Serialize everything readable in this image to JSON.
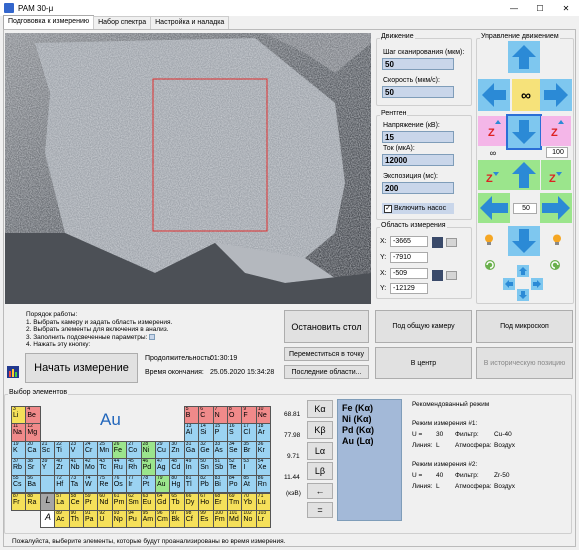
{
  "window": {
    "title": "РАМ 30-μ",
    "minimize": "—",
    "maximize": "☐",
    "close": "✕"
  },
  "tabs": [
    "Подгововка к измерению",
    "Набор спектра",
    "Настройка и наладка"
  ],
  "colors": {
    "accent": "#36c",
    "field": "#c9d6ea",
    "arrow": "#7ec7ef",
    "pink": "#f4b6e8",
    "green": "#9be58c"
  },
  "movement": {
    "group": "Движение",
    "step_label": "Шаг сканирования (мкм):",
    "step_value": "50",
    "speed_label": "Скорость (мкм/с):",
    "speed_value": "50"
  },
  "xray": {
    "group": "Рентген",
    "voltage_label": "Напряжение (кВ):",
    "voltage_value": "15",
    "current_label": "Ток (мкА):",
    "current_value": "12000",
    "exposure_label": "Экспозиция (мс):",
    "exposure_value": "200",
    "pump_label": "Включить насос"
  },
  "area": {
    "group": "Область измерения",
    "x1": "-3665",
    "y1": "-7910",
    "x2": "-509",
    "y2": "-12129",
    "x_label": "X:",
    "y_label": "Y:"
  },
  "control": {
    "group": "Управление движением",
    "inf": "∞",
    "speed_inf": "∞",
    "speed_100": "100",
    "step_50": "50"
  },
  "procedure": {
    "title": "Порядок работы:",
    "steps": [
      "1. Выбрать камеру и задать область измерения.",
      "2. Выбрать элементы для включения в анализ.",
      "3. Заполнить подсвеченные параметры:",
      "4. Нажать эту кнопку:"
    ]
  },
  "actions": {
    "stop_table": "Остановить стол",
    "general_camera": "Под общую камеру",
    "microscope": "Под микроскоп",
    "move_to_point": "Переместиться в точку",
    "last_areas": "Последние области...",
    "center": "В центр",
    "historic": "В историческую позицию",
    "start": "Начать измерение"
  },
  "timing": {
    "duration_label": "Продолжительность:",
    "duration_value": "01:30:19",
    "end_label": "Время окончания:",
    "end_value": "25.05.2020 15:34:28"
  },
  "elements": {
    "group": "Выбор элементов",
    "selected_symbol": "Au",
    "lines": [
      "Kα",
      "Kβ",
      "Lα",
      "Lβ",
      "←",
      "="
    ],
    "energies": [
      "68.81",
      "77.98",
      "9.71",
      "11.44",
      "(кэВ)"
    ],
    "selected_list": [
      "Fe (Kα)",
      "Ni (Kα)",
      "Pd (Kα)",
      "Au (Lα)"
    ],
    "footer": "Пожалуйста, выберите элементы, которые будут проанализированы во время измерения."
  },
  "recommended": {
    "group": "Рекомендованный режим",
    "mode1": {
      "title": "Режим измерения #1:",
      "u_label": "U =",
      "u": "30",
      "filter_label": "Фильтр:",
      "filter": "Cu-40",
      "line_label": "Линия:",
      "line": "L",
      "atm_label": "Атмосфера:",
      "atm": "Воздух"
    },
    "mode2": {
      "title": "Режим измерения #2:",
      "u_label": "U =",
      "u": "40",
      "filter_label": "Фильтр:",
      "filter": "Zr-50",
      "line_label": "Линия:",
      "line": "L",
      "atm_label": "Атмосфера:",
      "atm": "Воздух"
    }
  },
  "periodic": [
    [
      "5",
      "B",
      "#f08a8a"
    ],
    [
      "6",
      "C",
      "#f08a8a"
    ],
    [
      "7",
      "N",
      "#f08a8a"
    ],
    [
      "8",
      "O",
      "#f08a8a"
    ],
    [
      "9",
      "F",
      "#f08a8a"
    ],
    [
      "10",
      "Ne",
      "#f08a8a"
    ],
    [
      "3",
      "Li",
      "#f5e05a"
    ],
    [
      "4",
      "Be",
      "#f08a8a"
    ],
    [
      "11",
      "Na",
      "#f08a8a"
    ],
    [
      "12",
      "Mg",
      "#f08a8a"
    ],
    [
      "13",
      "Al",
      "#9bd3f2"
    ],
    [
      "14",
      "Si",
      "#9bd3f2"
    ],
    [
      "15",
      "P",
      "#9bd3f2"
    ],
    [
      "16",
      "S",
      "#9bd3f2"
    ],
    [
      "17",
      "Cl",
      "#9bd3f2"
    ],
    [
      "18",
      "Ar",
      "#9bd3f2"
    ],
    [
      "19",
      "K",
      "#9bd3f2"
    ],
    [
      "20",
      "Ca",
      "#9bd3f2"
    ],
    [
      "21",
      "Sc",
      "#9bd3f2"
    ],
    [
      "22",
      "Ti",
      "#9bd3f2"
    ],
    [
      "23",
      "V",
      "#9bd3f2"
    ],
    [
      "24",
      "Cr",
      "#9bd3f2"
    ],
    [
      "25",
      "Mn",
      "#9bd3f2"
    ],
    [
      "26",
      "Fe",
      "#9be58c"
    ],
    [
      "27",
      "Co",
      "#9bd3f2"
    ],
    [
      "28",
      "Ni",
      "#9be58c"
    ],
    [
      "29",
      "Cu",
      "#9bd3f2"
    ],
    [
      "30",
      "Zn",
      "#9bd3f2"
    ],
    [
      "31",
      "Ga",
      "#9bd3f2"
    ],
    [
      "32",
      "Ge",
      "#9bd3f2"
    ],
    [
      "33",
      "As",
      "#9bd3f2"
    ],
    [
      "34",
      "Se",
      "#9bd3f2"
    ],
    [
      "35",
      "Br",
      "#9bd3f2"
    ],
    [
      "36",
      "Kr",
      "#9bd3f2"
    ],
    [
      "37",
      "Rb",
      "#9bd3f2"
    ],
    [
      "38",
      "Sr",
      "#9bd3f2"
    ],
    [
      "39",
      "Y",
      "#9bd3f2"
    ],
    [
      "40",
      "Zr",
      "#9bd3f2"
    ],
    [
      "41",
      "Nb",
      "#9bd3f2"
    ],
    [
      "42",
      "Mo",
      "#9bd3f2"
    ],
    [
      "43",
      "Tc",
      "#9bd3f2"
    ],
    [
      "44",
      "Ru",
      "#9bd3f2"
    ],
    [
      "45",
      "Rh",
      "#9bd3f2"
    ],
    [
      "46",
      "Pd",
      "#9be58c"
    ],
    [
      "47",
      "Ag",
      "#9bd3f2"
    ],
    [
      "48",
      "Cd",
      "#9bd3f2"
    ],
    [
      "49",
      "In",
      "#9bd3f2"
    ],
    [
      "50",
      "Sn",
      "#9bd3f2"
    ],
    [
      "51",
      "Sb",
      "#9bd3f2"
    ],
    [
      "52",
      "Te",
      "#9bd3f2"
    ],
    [
      "53",
      "I",
      "#9bd3f2"
    ],
    [
      "54",
      "Xe",
      "#9bd3f2"
    ],
    [
      "55",
      "Cs",
      "#9bd3f2"
    ],
    [
      "56",
      "Ba",
      "#9bd3f2"
    ],
    [
      "",
      "",
      "#9bd3f2"
    ],
    [
      "72",
      "Hf",
      "#9bd3f2"
    ],
    [
      "73",
      "Ta",
      "#9bd3f2"
    ],
    [
      "74",
      "W",
      "#9bd3f2"
    ],
    [
      "75",
      "Re",
      "#9bd3f2"
    ],
    [
      "76",
      "Os",
      "#9bd3f2"
    ],
    [
      "77",
      "Ir",
      "#9bd3f2"
    ],
    [
      "78",
      "Pt",
      "#9bd3f2"
    ],
    [
      "79",
      "Au",
      "#9be58c"
    ],
    [
      "80",
      "Hg",
      "#9bd3f2"
    ],
    [
      "81",
      "Tl",
      "#9bd3f2"
    ],
    [
      "82",
      "Pb",
      "#9bd3f2"
    ],
    [
      "83",
      "Bi",
      "#9bd3f2"
    ],
    [
      "84",
      "Po",
      "#9bd3f2"
    ],
    [
      "85",
      "At",
      "#9bd3f2"
    ],
    [
      "86",
      "Rn",
      "#9bd3f2"
    ],
    [
      "87",
      "Fr",
      "#f5e05a"
    ],
    [
      "88",
      "Ra",
      "#f5e05a"
    ],
    [
      "",
      "L",
      "#a6a6a6"
    ],
    [
      "57",
      "La",
      "#f5e05a"
    ],
    [
      "58",
      "Ce",
      "#f5e05a"
    ],
    [
      "59",
      "Pr",
      "#f5e05a"
    ],
    [
      "60",
      "Nd",
      "#f5e05a"
    ],
    [
      "61",
      "Pm",
      "#f5e05a"
    ],
    [
      "62",
      "Sm",
      "#f5e05a"
    ],
    [
      "63",
      "Eu",
      "#f5e05a"
    ],
    [
      "64",
      "Gd",
      "#f5e05a"
    ],
    [
      "65",
      "Tb",
      "#f5e05a"
    ],
    [
      "66",
      "Dy",
      "#f5e05a"
    ],
    [
      "67",
      "Ho",
      "#f5e05a"
    ],
    [
      "68",
      "Er",
      "#f5e05a"
    ],
    [
      "69",
      "Tm",
      "#f5e05a"
    ],
    [
      "70",
      "Yb",
      "#f5e05a"
    ],
    [
      "71",
      "Lu",
      "#f5e05a"
    ],
    [
      "",
      "A",
      "#fff"
    ],
    [
      "89",
      "Ac",
      "#f5e05a"
    ],
    [
      "90",
      "Th",
      "#f5e05a"
    ],
    [
      "91",
      "Pa",
      "#f5e05a"
    ],
    [
      "92",
      "U",
      "#f5e05a"
    ],
    [
      "93",
      "Np",
      "#f5e05a"
    ],
    [
      "94",
      "Pu",
      "#f5e05a"
    ],
    [
      "95",
      "Am",
      "#f5e05a"
    ],
    [
      "96",
      "Cm",
      "#f5e05a"
    ],
    [
      "97",
      "Bk",
      "#f5e05a"
    ],
    [
      "98",
      "Cf",
      "#f5e05a"
    ],
    [
      "99",
      "Es",
      "#f5e05a"
    ],
    [
      "100",
      "Fm",
      "#f5e05a"
    ],
    [
      "101",
      "Md",
      "#f5e05a"
    ],
    [
      "102",
      "No",
      "#f5e05a"
    ],
    [
      "103",
      "Lr",
      "#f5e05a"
    ]
  ]
}
